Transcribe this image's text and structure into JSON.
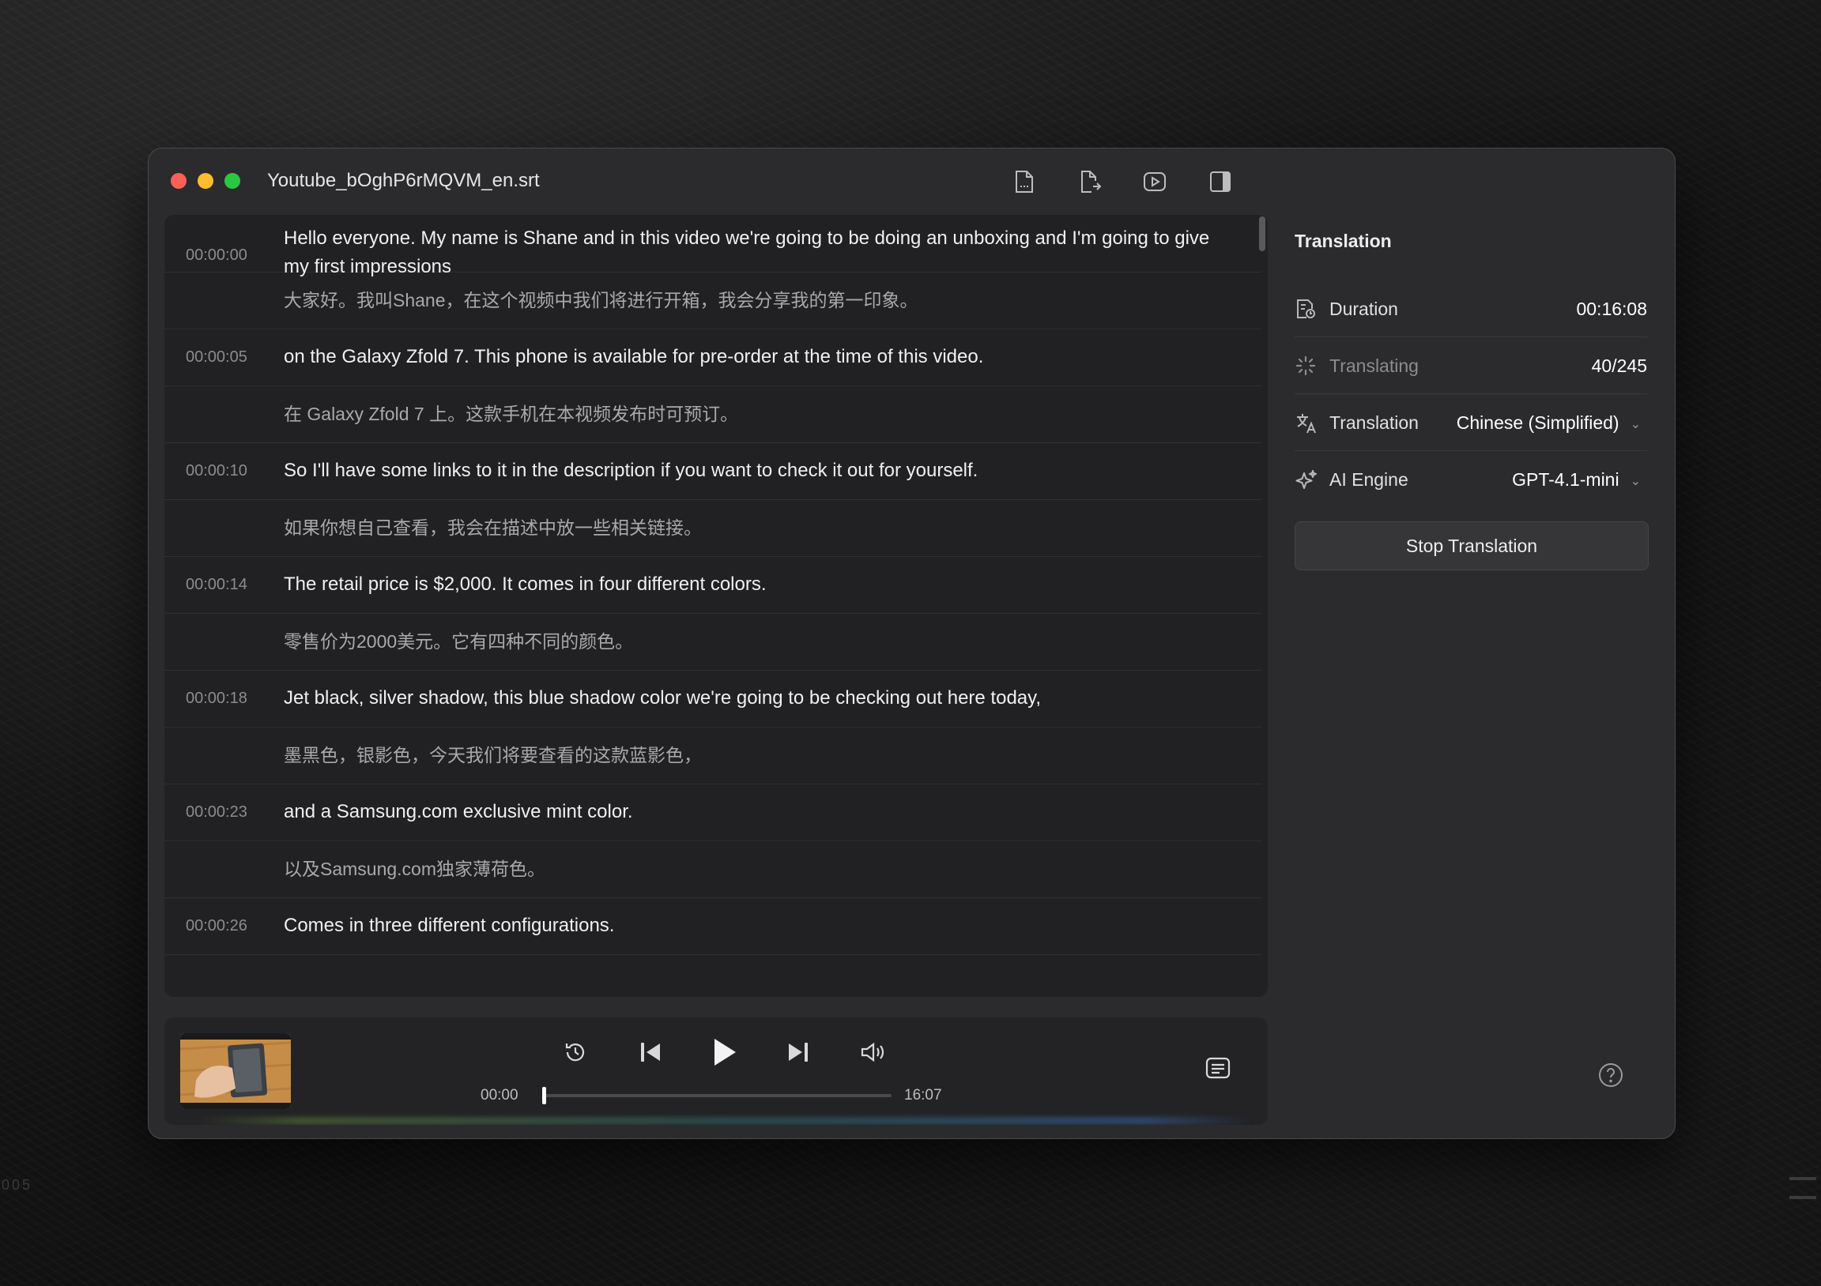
{
  "window": {
    "title": "Youtube_bOghP6rMQVM_en.srt"
  },
  "toolbar": {
    "icons": [
      "subtitle-file-icon",
      "export-file-icon",
      "video-play-icon",
      "sidebar-toggle-icon"
    ]
  },
  "subtitles": [
    {
      "time": "00:00:00",
      "en": "Hello everyone. My name is Shane and in this video we're going to be doing an unboxing and I'm going to give my first impressions",
      "zh": "大家好。我叫Shane，在这个视频中我们将进行开箱，我会分享我的第一印象。"
    },
    {
      "time": "00:00:05",
      "en": "on the Galaxy Zfold 7. This phone is available for pre-order at the time of this video.",
      "zh": "在 Galaxy Zfold 7 上。这款手机在本视频发布时可预订。"
    },
    {
      "time": "00:00:10",
      "en": "So I'll have some links to it in the description if you want to check it out for yourself.",
      "zh": "如果你想自己查看，我会在描述中放一些相关链接。"
    },
    {
      "time": "00:00:14",
      "en": "The retail price is $2,000. It comes in four different colors.",
      "zh": "零售价为2000美元。它有四种不同的颜色。"
    },
    {
      "time": "00:00:18",
      "en": "Jet black, silver shadow, this blue shadow color we're going to be checking out here today,",
      "zh": "墨黑色，银影色，今天我们将要查看的这款蓝影色，"
    },
    {
      "time": "00:00:23",
      "en": "and a Samsung.com exclusive mint color.",
      "zh": "以及Samsung.com独家薄荷色。"
    },
    {
      "time": "00:00:26",
      "en": "Comes in three different configurations.",
      "zh": ""
    }
  ],
  "player": {
    "current_time": "00:00",
    "total_time": "16:07",
    "progress": 0.0
  },
  "sidebar": {
    "title": "Translation",
    "duration_label": "Duration",
    "duration_value": "00:16:08",
    "translating_label": "Translating",
    "translating_value": "40/245",
    "translation_label": "Translation",
    "translation_value": "Chinese (Simplified)",
    "engine_label": "AI Engine",
    "engine_value": "GPT-4.1-mini",
    "stop_button": "Stop Translation"
  },
  "background": {
    "label": "005"
  }
}
